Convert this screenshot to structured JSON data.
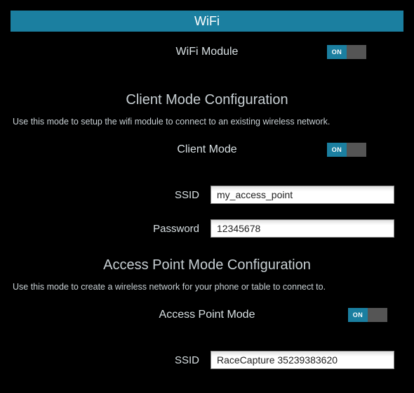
{
  "header": {
    "title": "WiFi"
  },
  "wifi_module": {
    "label": "WiFi Module",
    "toggle_text": "ON",
    "state": true
  },
  "client_mode": {
    "section_title": "Client Mode Configuration",
    "description": "Use this mode to setup the wifi module to connect to an existing wireless network.",
    "toggle_label": "Client Mode",
    "toggle_text": "ON",
    "state": true,
    "ssid_label": "SSID",
    "ssid_value": "my_access_point",
    "password_label": "Password",
    "password_value": "12345678"
  },
  "ap_mode": {
    "section_title": "Access Point Mode Configuration",
    "description": "Use this mode to create a wireless network for your phone or table to connect to.",
    "toggle_label": "Access Point Mode",
    "toggle_text": "ON",
    "state": true,
    "ssid_label": "SSID",
    "ssid_value": "RaceCapture 35239383620"
  }
}
